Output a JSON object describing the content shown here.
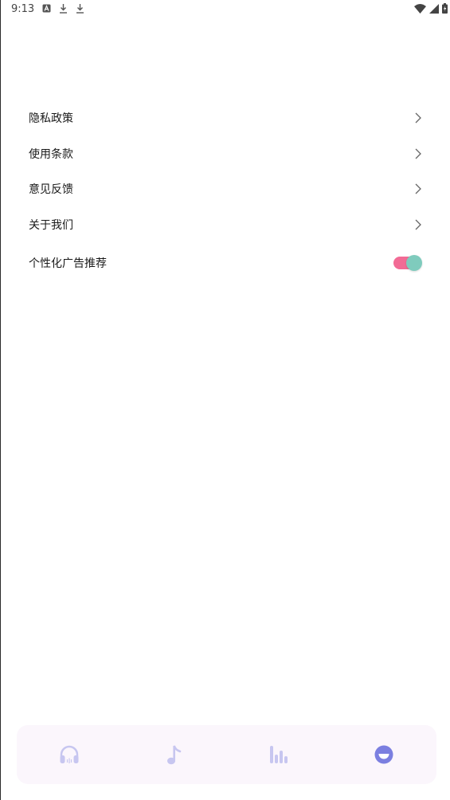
{
  "status_bar": {
    "time": "9:13",
    "left_icons": [
      "a-icon",
      "download-icon",
      "download-icon"
    ],
    "right_icons": [
      "wifi-icon",
      "signal-icon",
      "battery-icon"
    ]
  },
  "settings": {
    "items": [
      {
        "label": "隐私政策"
      },
      {
        "label": "使用条款"
      },
      {
        "label": "意见反馈"
      },
      {
        "label": "关于我们"
      }
    ],
    "toggle": {
      "label": "个性化广告推荐",
      "state": true,
      "track_color": "#f26b95",
      "thumb_color": "#7fcbbd"
    }
  },
  "bottom_nav": {
    "background": "#fbf6fc",
    "items": [
      {
        "icon": "headphones-icon",
        "active": false
      },
      {
        "icon": "music-note-icon",
        "active": false
      },
      {
        "icon": "equalizer-icon",
        "active": false
      },
      {
        "icon": "smile-icon",
        "active": true
      }
    ],
    "active_color": "#7b7fe0",
    "inactive_color": "#c7c6f0"
  }
}
